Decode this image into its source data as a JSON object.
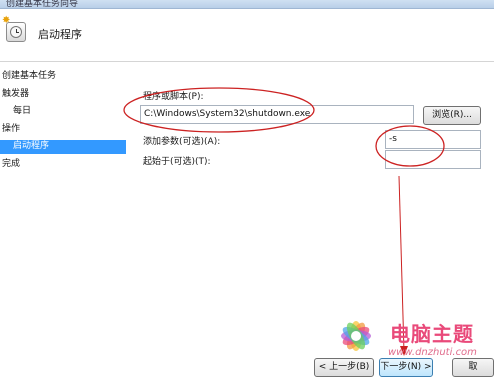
{
  "window": {
    "title": "创建基本任务向导"
  },
  "header": {
    "title": "启动程序"
  },
  "sidebar": {
    "items": [
      {
        "label": "创建基本任务"
      },
      {
        "label": "触发器"
      },
      {
        "label": "每日"
      },
      {
        "label": "操作"
      },
      {
        "label": "启动程序"
      },
      {
        "label": "完成"
      }
    ],
    "selected": "启动程序"
  },
  "form": {
    "program_label": "程序或脚本(P):",
    "program_value": "C:\\Windows\\System32\\shutdown.exe",
    "browse_label": "浏览(R)...",
    "args_label": "添加参数(可选)(A):",
    "args_value": "-s",
    "startin_label": "起始于(可选)(T):",
    "startin_value": ""
  },
  "buttons": {
    "back_label": "< 上一步(B)",
    "next_label": "下一步(N) >",
    "cancel_label": "取"
  },
  "watermark": {
    "title": "电脑主题",
    "url": "www.dnzhuti.com"
  },
  "colors": {
    "selection": "#3399ff",
    "annotation": "#cc2222"
  }
}
